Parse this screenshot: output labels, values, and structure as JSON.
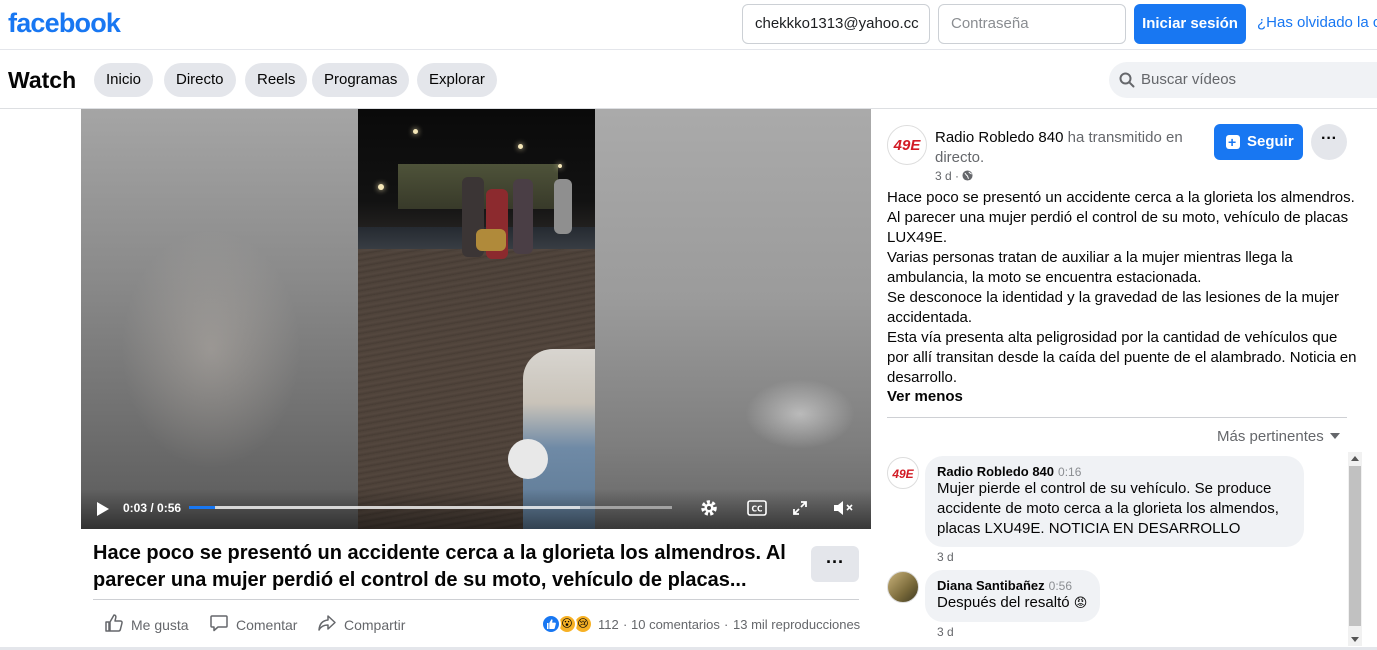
{
  "topbar": {
    "logo": "facebook",
    "email_value": "chekkko1313@yahoo.cc",
    "password_placeholder": "Contraseña",
    "login_label": "Iniciar sesión",
    "forgot_label": "¿Has olvidado la c"
  },
  "watchbar": {
    "title": "Watch",
    "tabs": [
      {
        "label": "Inicio"
      },
      {
        "label": "Directo"
      },
      {
        "label": "Reels"
      },
      {
        "label": "Programas"
      },
      {
        "label": "Explorar"
      }
    ],
    "search_placeholder": "Buscar vídeos"
  },
  "video": {
    "time": "0:03 / 0:56",
    "progress_fraction": 0.054,
    "buffered_fraction": 0.81,
    "caption": "Hace poco se presentó un accidente cerca a la glorieta los almendros. Al parecer una mujer perdió el control de su moto, vehículo de placas...",
    "more_label": "···"
  },
  "actions": {
    "like": "Me gusta",
    "comment": "Comentar",
    "share": "Compartir",
    "reaction_count": "112",
    "comments": "10 comentarios",
    "views": "13 mil reproducciones",
    "separator": "·"
  },
  "post": {
    "page_name": "Radio Robledo 840",
    "action_text": " ha transmitido en directo.",
    "time": "3 d ·",
    "follow_label": "Seguir",
    "menu_label": "···",
    "avatar_text": "49E",
    "paragraphs": [
      "Hace poco se presentó un accidente cerca a la glorieta los almendros.",
      "Al parecer una mujer perdió el control de su moto, vehículo de placas LUX49E.",
      "Varias personas tratan de auxiliar a la mujer mientras llega la ambulancia, la moto se encuentra estacionada.",
      "Se desconoce la identidad y la gravedad de las lesiones de la mujer accidentada.",
      "Esta vía presenta alta peligrosidad por la cantidad de vehículos que por allí transitan desde la caída del puente de el alambrado. Noticia en desarrollo."
    ],
    "see_less": "Ver menos",
    "sort_label": "Más pertinentes"
  },
  "comments": [
    {
      "author": "Radio Robledo 840",
      "timestamp": "0:16",
      "text": "Mujer pierde el control de su vehículo. Se produce accidente de moto cerca a la glorieta los almendos, placas LXU49E. NOTICIA EN DESARROLLO",
      "age": "3 d"
    },
    {
      "author": "Diana Santibañez",
      "timestamp": "0:56",
      "text": "Después del resaltó",
      "emoji": "😡",
      "age": "3 d"
    }
  ],
  "colors": {
    "brand": "#1877f2",
    "pill_bg": "#e4e6eb",
    "bubble_bg": "#f0f2f5",
    "secondary_text": "#65676b"
  }
}
